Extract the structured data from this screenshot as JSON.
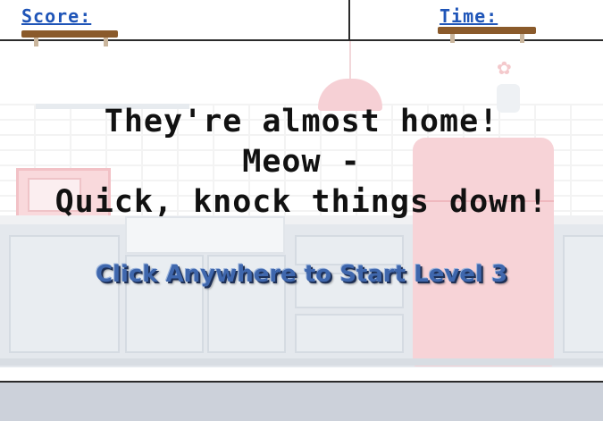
{
  "hud": {
    "score_label": "Score:",
    "time_label": "Time:"
  },
  "message": {
    "line1": "They're almost home!",
    "line2": "Meow -",
    "line3": "Quick, knock things down!"
  },
  "prompt": {
    "start_label": "Click Anywhere to Start Level 3"
  },
  "colors": {
    "hud_text": "#1f55b8",
    "shelf": "#8a5a2b",
    "prompt_text": "#3f67ad",
    "fridge": "#f7d3d7",
    "bottom_bar": "#ccd1da"
  },
  "icons": {
    "flower": "✿"
  }
}
